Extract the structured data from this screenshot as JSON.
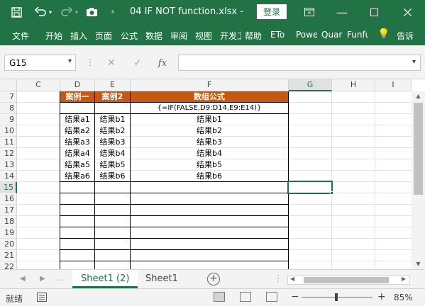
{
  "window": {
    "title": "04 IF NOT function.xlsx  -",
    "login": "登录"
  },
  "ribbon": {
    "tabs": [
      "文件",
      "开始",
      "插入",
      "页面",
      "公式",
      "数据",
      "审阅",
      "视图",
      "开发工",
      "帮助",
      "ETo",
      "Powe",
      "Quar",
      "Funfu",
      "告诉"
    ]
  },
  "formula_bar": {
    "name_box": "G15",
    "fx_label": "fx",
    "formula": ""
  },
  "columns": [
    "C",
    "D",
    "E",
    "F",
    "G",
    "H",
    "I"
  ],
  "rows": [
    "7",
    "8",
    "9",
    "10",
    "11",
    "12",
    "13",
    "14",
    "15",
    "16",
    "17",
    "18",
    "19",
    "20",
    "21",
    "22"
  ],
  "table": {
    "headers": {
      "d": "案例一",
      "e": "案例2",
      "f": "数组公式"
    },
    "formula_text": "{=IF(FALSE,D9:D14,E9:E14)}",
    "rows": [
      {
        "d": "结果a1",
        "e": "结果b1",
        "f": "结果b1"
      },
      {
        "d": "结果a2",
        "e": "结果b2",
        "f": "结果b2"
      },
      {
        "d": "结果a3",
        "e": "结果b3",
        "f": "结果b3"
      },
      {
        "d": "结果a4",
        "e": "结果b4",
        "f": "结果b4"
      },
      {
        "d": "结果a5",
        "e": "结果b5",
        "f": "结果b5"
      },
      {
        "d": "结果a6",
        "e": "结果b6",
        "f": "结果b6"
      }
    ]
  },
  "selected_cell": "G15",
  "sheets": {
    "tabs": [
      "Sheet1 (2)",
      "Sheet1"
    ],
    "active": "Sheet1 (2)",
    "add": "+"
  },
  "status": {
    "ready": "就绪",
    "zoom": "85%",
    "minus": "−",
    "plus": "+"
  },
  "colors": {
    "excel_green": "#217346",
    "header_orange": "#c65911"
  }
}
